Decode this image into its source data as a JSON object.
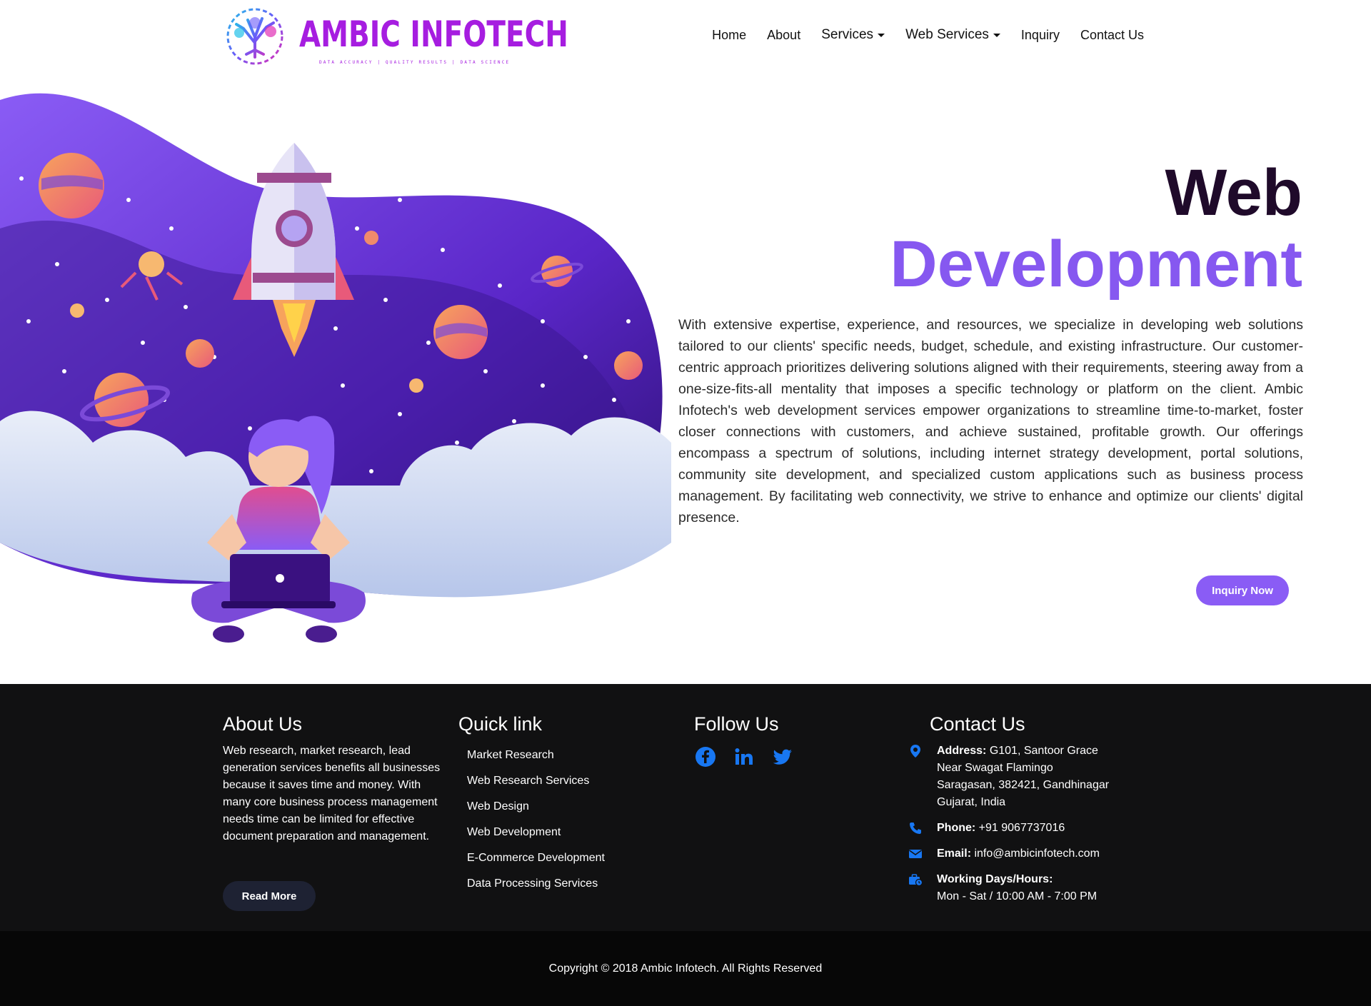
{
  "brand": {
    "name": "AMBIC INFOTECH",
    "tagline": "DATA ACCURACY | QUALITY RESULTS | DATA SCIENCE"
  },
  "nav": {
    "items": [
      {
        "label": "Home"
      },
      {
        "label": "About"
      },
      {
        "label": "Services"
      },
      {
        "label": "Web Services"
      },
      {
        "label": "Inquiry"
      },
      {
        "label": "Contact Us"
      }
    ]
  },
  "hero": {
    "title_line1": "Web",
    "title_line2": "Development",
    "description": "With extensive expertise, experience, and resources, we specialize in developing web solutions tailored to our clients' specific needs, budget, schedule, and existing infrastructure. Our customer-centric approach prioritizes delivering solutions aligned with their requirements, steering away from a one-size-fits-all mentality that imposes a specific technology or platform on the client. Ambic Infotech's web development services empower organizations to streamline time-to-market, foster closer connections with customers, and achieve sustained, profitable growth. Our offerings encompass a spectrum of solutions, including internet strategy development, portal solutions, community site development, and specialized custom applications such as business process management. By facilitating web connectivity, we strive to enhance and optimize our clients' digital presence.",
    "cta_label": "Inquiry Now"
  },
  "footer": {
    "about": {
      "heading": "About Us",
      "text": "Web research, market research, lead generation services benefits all businesses because it saves time and money. With many core business process management needs time can be limited for effective document preparation and management.",
      "button_label": "Read More"
    },
    "quick": {
      "heading": "Quick link",
      "links": [
        {
          "label": "Market Research"
        },
        {
          "label": "Web Research Services"
        },
        {
          "label": "Web Design"
        },
        {
          "label": "Web Development"
        },
        {
          "label": "E-Commerce Development"
        },
        {
          "label": "Data Processing Services"
        }
      ]
    },
    "follow": {
      "heading": "Follow Us",
      "icons": [
        "facebook-icon",
        "linkedin-icon",
        "twitter-icon"
      ]
    },
    "contact": {
      "heading": "Contact Us",
      "address_label": "Address:",
      "address_line1": "G101, Santoor Grace",
      "address_line2": "Near Swagat Flamingo",
      "address_line3": "Saragasan, 382421, Gandhinagar",
      "address_line4": "Gujarat, India",
      "phone_label": "Phone:",
      "phone": "+91 9067737016",
      "email_label": "Email:",
      "email": "info@ambicinfotech.com",
      "hours_label": "Working Days/Hours:",
      "hours": "Mon - Sat / 10:00 AM - 7:00 PM"
    },
    "copyright": "Copyright © 2018 Ambic Infotech. All Rights Reserved"
  },
  "colors": {
    "accent": "#8a5cf5",
    "brand": "#a61de0",
    "footer_bg": "#111112",
    "icon_blue": "#1877f2"
  }
}
